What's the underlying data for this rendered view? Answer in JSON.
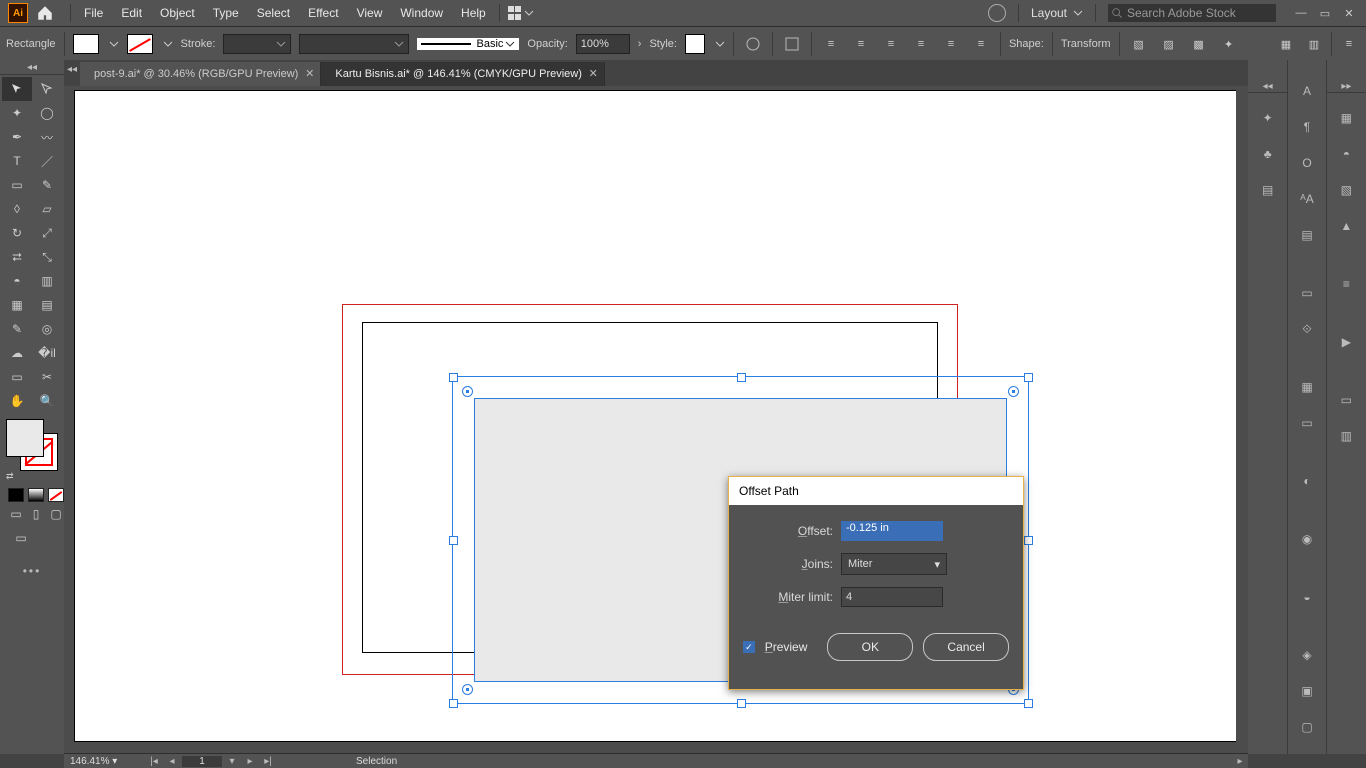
{
  "app_badge": "Ai",
  "menu": [
    "File",
    "Edit",
    "Object",
    "Type",
    "Select",
    "Effect",
    "View",
    "Window",
    "Help"
  ],
  "layout_label": "Layout",
  "search_placeholder": "Search Adobe Stock",
  "options": {
    "shape": "Rectangle",
    "stroke_label": "Stroke:",
    "stroke_value": "",
    "brush_basic": "Basic",
    "opacity_label": "Opacity:",
    "opacity_value": "100%",
    "style_label": "Style:",
    "shape_panel": "Shape:",
    "transform": "Transform"
  },
  "tabs": [
    {
      "label": "post-9.ai* @ 30.46% (RGB/GPU Preview)",
      "active": false
    },
    {
      "label": "Kartu Bisnis.ai* @ 146.41% (CMYK/GPU Preview)",
      "active": true
    }
  ],
  "status": {
    "zoom": "146.41%",
    "artboard": "1",
    "tool": "Selection"
  },
  "dialog": {
    "title": "Offset Path",
    "offset_label": "Offset:",
    "offset_value": "-0.125 in",
    "joins_label": "Joins:",
    "joins_value": "Miter",
    "miter_label": "Miter limit:",
    "miter_value": "4",
    "preview": "Preview",
    "ok": "OK",
    "cancel": "Cancel"
  }
}
